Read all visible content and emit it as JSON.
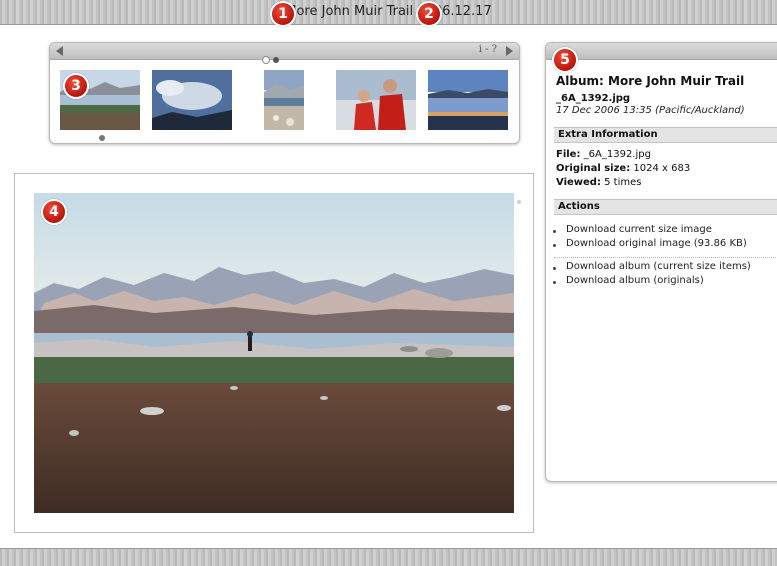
{
  "header": {
    "title": "More John Muir Trail",
    "date": "2006.12.17"
  },
  "markers": [
    "1",
    "2",
    "3",
    "4",
    "5"
  ],
  "filmstrip": {
    "help_label": "i - ?",
    "page_dots": [
      {
        "active": true
      },
      {
        "active": false
      }
    ],
    "thumbnails": [
      {
        "name": "thumb-lake-reflection",
        "selected": true
      },
      {
        "name": "thumb-clouds-sky",
        "selected": false
      },
      {
        "name": "thumb-lakeshore-portrait",
        "selected": false
      },
      {
        "name": "thumb-hikers-red-jackets",
        "selected": false
      },
      {
        "name": "thumb-dusk-lake",
        "selected": false
      }
    ]
  },
  "photo": {
    "subject": "lake-mountains-photo"
  },
  "info": {
    "album_title": "Album: More John Muir Trail",
    "file_name": "_6A_1392.jpg",
    "date": "17 Dec 2006 13:35 (Pacific/Auckland)",
    "extra_heading": "Extra Information",
    "file_label": "File:",
    "file_value": "_6A_1392.jpg",
    "size_label": "Original size:",
    "size_value": "1024 x 683",
    "viewed_label": "Viewed:",
    "viewed_value": "5 times",
    "actions_heading": "Actions",
    "actions": [
      "Download current size image",
      "Download original image (93.86 KB)",
      "Download album (current size items)",
      "Download album (originals)"
    ]
  },
  "colors": {
    "marker_red": "#c81e12",
    "dot_active": "#ffffff",
    "dot_inactive": "#555555"
  }
}
